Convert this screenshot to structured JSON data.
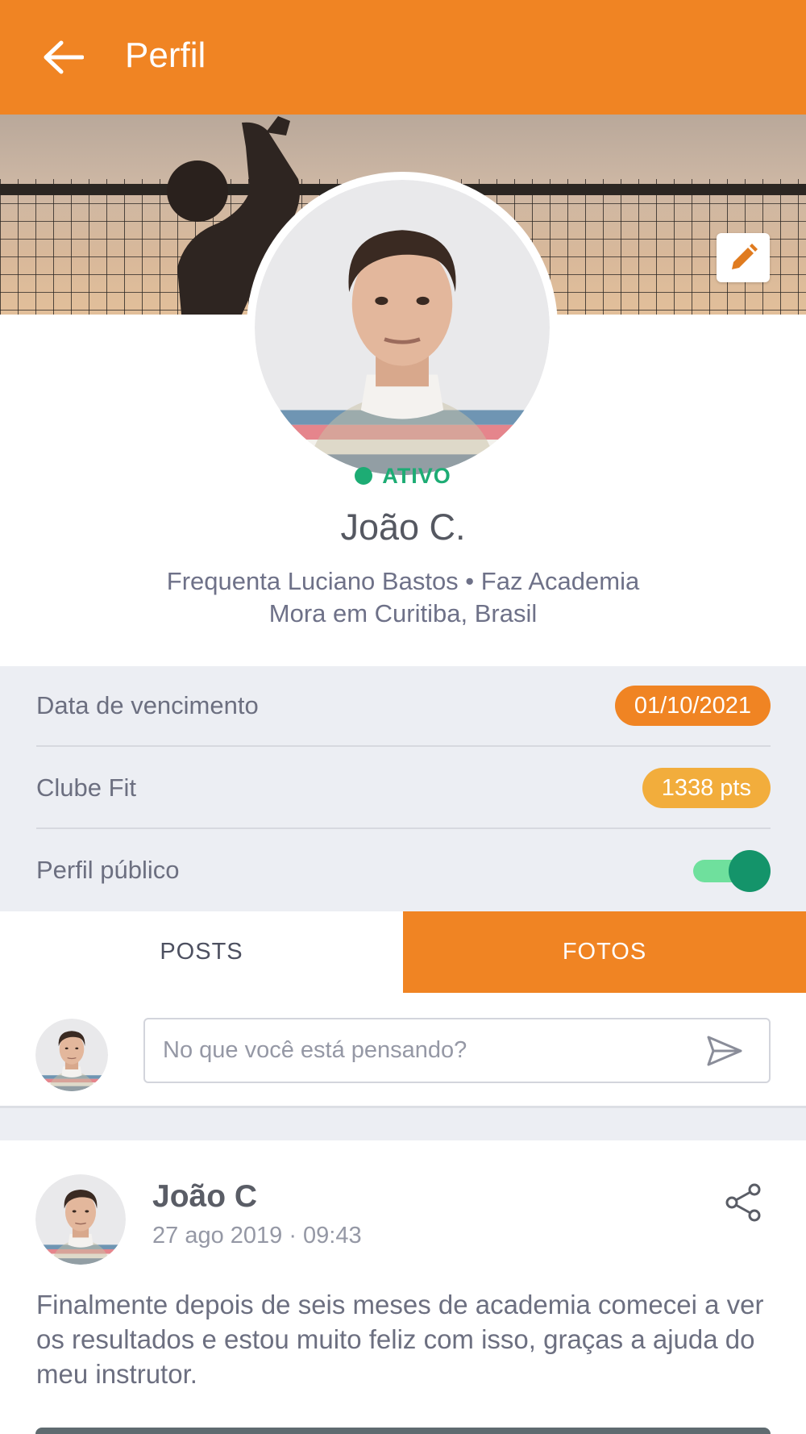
{
  "appbar": {
    "title": "Perfil",
    "back_icon": "arrow-left-icon",
    "color": "#f08423"
  },
  "cover": {
    "edit_icon": "pencil-icon"
  },
  "profile": {
    "status": "ATIVO",
    "status_color": "#1dac74",
    "name": "João C.",
    "info_line1": "Frequenta Luciano Bastos • Faz Academia",
    "info_line2": "Mora em Curitiba, Brasil"
  },
  "settings": {
    "rows": [
      {
        "label": "Data de vencimento",
        "value": "01/10/2021",
        "color": "#f08423"
      },
      {
        "label": "Clube Fit",
        "value": "1338 pts",
        "color": "#f2ad3c"
      },
      {
        "label": "Perfil público",
        "toggle_on": true
      }
    ]
  },
  "tabs": [
    {
      "label": "POSTS",
      "active": false
    },
    {
      "label": "FOTOS",
      "active": true
    }
  ],
  "composer": {
    "placeholder": "No que você está pensando?",
    "send_icon": "send-icon"
  },
  "post": {
    "author": "João C",
    "date": "27 ago 2019 · 09:43",
    "share_icon": "share-icon",
    "text": "Finalmente depois de seis meses de academia comecei a ver os resultados e estou muito feliz com isso, graças a ajuda do meu instrutor."
  }
}
